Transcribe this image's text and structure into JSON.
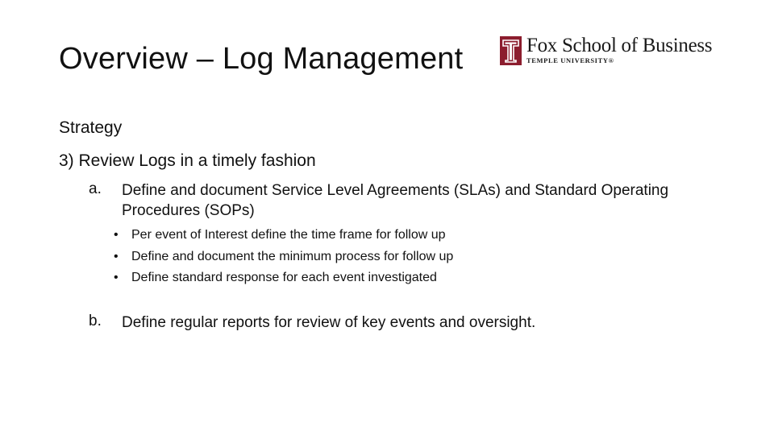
{
  "slide": {
    "title": "Overview – Log Management",
    "logo": {
      "name": "Fox School of Business",
      "subtitle": "TEMPLE UNIVERSITY®",
      "mark_icon": "temple-t-logo-icon",
      "brand_color": "#8c1d2e"
    },
    "headings": [
      "Strategy",
      "3) Review Logs in a timely fashion"
    ],
    "items": [
      {
        "marker": "a.",
        "text": "Define and document Service Level Agreements (SLAs) and Standard Operating Procedures (SOPs)",
        "bullets": [
          "Per event of Interest define the time frame for follow up",
          "Define and document the minimum process for follow up",
          "Define standard response for each event investigated"
        ]
      },
      {
        "marker": "b.",
        "text": "Define regular reports for review of key events and oversight."
      }
    ],
    "bullet_glyph": "•"
  }
}
